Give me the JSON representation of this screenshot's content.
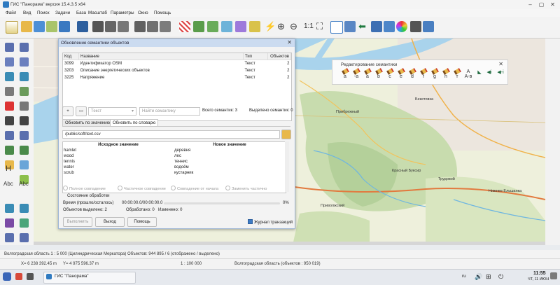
{
  "window": {
    "title": "ГИС \"Панорама\" версия 15.4.3.5 x64",
    "controls": [
      "–",
      "▢",
      "✕"
    ]
  },
  "menu": [
    "Файл",
    "Вид",
    "Поиск",
    "Задачи",
    "База",
    "Масштаб",
    "Параметры",
    "Окно",
    "Помощь"
  ],
  "toolbar": {
    "scale_label": "1:1"
  },
  "map_labels": [
    {
      "text": "Прибрежный",
      "key": "pribrezhny"
    },
    {
      "text": "Бекетовка",
      "key": "beketovka"
    },
    {
      "text": "Красный Буксир",
      "key": "bukhsir"
    },
    {
      "text": "Трудовой",
      "key": "trudovoy"
    },
    {
      "text": "Приволжский",
      "key": "privolzhsky"
    },
    {
      "text": "Нижнее Ельшанка",
      "key": "elshanka"
    }
  ],
  "palette": {
    "title": "Редактирование семантики"
  },
  "dialog": {
    "title": "Обновление семантики объектов",
    "columns": [
      "Код",
      "Название",
      "Тип",
      "Объектов"
    ],
    "rows": [
      {
        "code": "3099",
        "name": "Идентификатор OSM",
        "type": "Текст",
        "count": "2"
      },
      {
        "code": "3203",
        "name": "Описание энергетических объектов",
        "type": "Текст",
        "count": "2"
      },
      {
        "code": "3225",
        "name": "Напряжение",
        "type": "Текст",
        "count": "2"
      }
    ],
    "type_select": "Текст",
    "search_placeholder": "Найти семантику",
    "total_semantics": "Всего семантик: 3",
    "selected_semantics": "Выделено семантик: 0",
    "tabs": [
      "Обновить по значению",
      "Обновить по словарю"
    ],
    "dict_path": "/public/soft/text.csv",
    "dict_columns": [
      "Исходное значение",
      "Новое значение"
    ],
    "dict_rows": [
      {
        "src": "hamlet",
        "dst": "деревня"
      },
      {
        "src": "wood",
        "dst": "лес"
      },
      {
        "src": "tennis",
        "dst": "теннис"
      },
      {
        "src": "water",
        "dst": "водоём"
      },
      {
        "src": "scrub",
        "dst": "кустарник"
      }
    ],
    "radios": [
      "Полное совпадение",
      "Частичное совпадение",
      "Совпадение от начала",
      "Заменить частично"
    ],
    "processing_state": "Состояние обработки",
    "time_label": "Время (прошло/осталось)",
    "time_value": "00:00:00.0/00:00:00.0",
    "progress_pct": "0%",
    "selected_objects": "Объектов выделено: 2",
    "processed": "Обработано: 0",
    "changed": "Изменено: 0",
    "btn_execute": "Выполнить",
    "btn_exit": "Выход",
    "btn_help": "Помощь",
    "journal_label": "Журнал транзакций",
    "journal_checked": true
  },
  "status": {
    "line1": "Волгоградская область   1 : 5 000 (Цилиндрическая Меркатора) Объектов: 944 895 / 6 (отображено / выделено)",
    "coords_x": "X= 6 238 392.45 m",
    "coords_y": "Y= 4 975 596.37 m",
    "scale": "1 : 100 000",
    "region": "Волгоградская область   (объектов : 950 019)"
  },
  "taskbar": {
    "app": "ГИС \"Панорама\"",
    "lang": "ru",
    "time": "11:55",
    "date": "ЧТ, 11 ИЮН"
  }
}
